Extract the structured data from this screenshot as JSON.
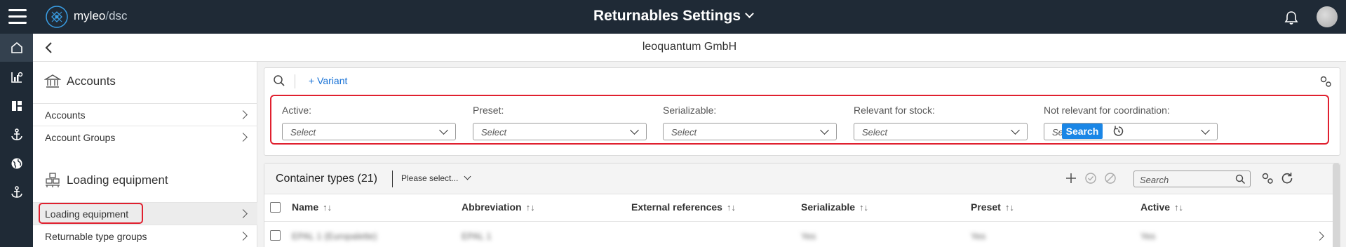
{
  "app": {
    "brand": "myleo",
    "brand_separator": "/",
    "brand_suffix": "dsc",
    "page_title": "Returnables Settings",
    "company": "leoquantum GmbH"
  },
  "rail": {
    "items": [
      {
        "icon": "home-icon"
      },
      {
        "icon": "analytics-icon"
      },
      {
        "icon": "dashboard-icon"
      },
      {
        "icon": "anchor-icon"
      },
      {
        "icon": "globe-icon"
      },
      {
        "icon": "anchor-icon"
      }
    ]
  },
  "nav": {
    "sections": [
      {
        "title": "Accounts",
        "icon": "bank-icon",
        "items": [
          "Accounts",
          "Account Groups"
        ]
      },
      {
        "title": "Loading equipment",
        "icon": "pallet-stack-icon",
        "items": [
          "Loading equipment",
          "Returnable type groups"
        ]
      }
    ],
    "selected": "Loading equipment"
  },
  "filters": {
    "variant_link": "+ Variant",
    "fields": [
      {
        "label": "Active:",
        "placeholder": "Select"
      },
      {
        "label": "Preset:",
        "placeholder": "Select"
      },
      {
        "label": "Serializable:",
        "placeholder": "Select"
      },
      {
        "label": "Relevant for stock:",
        "placeholder": "Select"
      },
      {
        "label": "Not relevant for coordination:",
        "placeholder": "Select"
      }
    ],
    "search_button": "Search"
  },
  "table": {
    "title": "Container types (21)",
    "view_select": "Please select...",
    "search_placeholder": "Search",
    "columns": [
      "Name",
      "Abbreviation",
      "External references",
      "Serializable",
      "Preset",
      "Active"
    ],
    "sort_glyph": "↑↓",
    "rows": [
      [
        "EPAL 1 (Europalette)",
        "EPAL 1",
        "",
        "Yes",
        "Yes",
        "Yes"
      ]
    ]
  },
  "colors": {
    "topbar": "#1f2a36",
    "accent": "#1a86e6",
    "highlight": "#e0202f"
  }
}
